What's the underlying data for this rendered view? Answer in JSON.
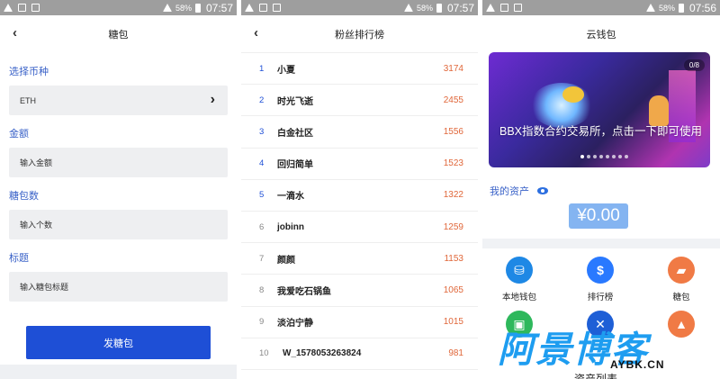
{
  "statusbar": {
    "battery": "58%",
    "times": [
      "07:57",
      "07:57",
      "07:56"
    ]
  },
  "panel1": {
    "title": "糖包",
    "fields": [
      {
        "label": "选择币种",
        "value": "ETH",
        "placeholder": ""
      },
      {
        "label": "金额",
        "value": "",
        "placeholder": "输入金额"
      },
      {
        "label": "糖包数",
        "value": "",
        "placeholder": "输入个数"
      },
      {
        "label": "标题",
        "value": "",
        "placeholder": "输入糖包标题"
      }
    ],
    "submit_label": "发糖包"
  },
  "panel2": {
    "title": "粉丝排行榜",
    "rows": [
      {
        "rank": "1",
        "name": "小夏",
        "count": "3174"
      },
      {
        "rank": "2",
        "name": "时光飞逝",
        "count": "2455"
      },
      {
        "rank": "3",
        "name": "白金社区",
        "count": "1556"
      },
      {
        "rank": "4",
        "name": "回归简单",
        "count": "1523"
      },
      {
        "rank": "5",
        "name": "一滴水",
        "count": "1322"
      },
      {
        "rank": "6",
        "name": "jobinn",
        "count": "1259"
      },
      {
        "rank": "7",
        "name": "颜颜",
        "count": "1153"
      },
      {
        "rank": "8",
        "name": "我爱吃石锅鱼",
        "count": "1065"
      },
      {
        "rank": "9",
        "name": "淡泊宁静",
        "count": "1015"
      },
      {
        "rank": "10",
        "name": "W_1578053263824",
        "count": "981"
      }
    ]
  },
  "panel3": {
    "title": "云钱包",
    "banner_caption": "BBX指数合约交易所，点击一下即可使用",
    "banner_pager": "0/8",
    "asset_label": "我的资产",
    "asset_value": "¥0.00",
    "tiles": [
      {
        "label": "本地钱包",
        "icon": "basket-icon",
        "color": "#1e88e5",
        "glyph": "⛁"
      },
      {
        "label": "排行榜",
        "icon": "dollar-icon",
        "color": "#2979ff",
        "glyph": "$"
      },
      {
        "label": "糖包",
        "icon": "truck-icon",
        "color": "#f07a45",
        "glyph": "▰"
      }
    ],
    "asset_list_title": "资产列表"
  },
  "watermark": {
    "text": "阿景博客",
    "sub": "AYBK.CN"
  }
}
